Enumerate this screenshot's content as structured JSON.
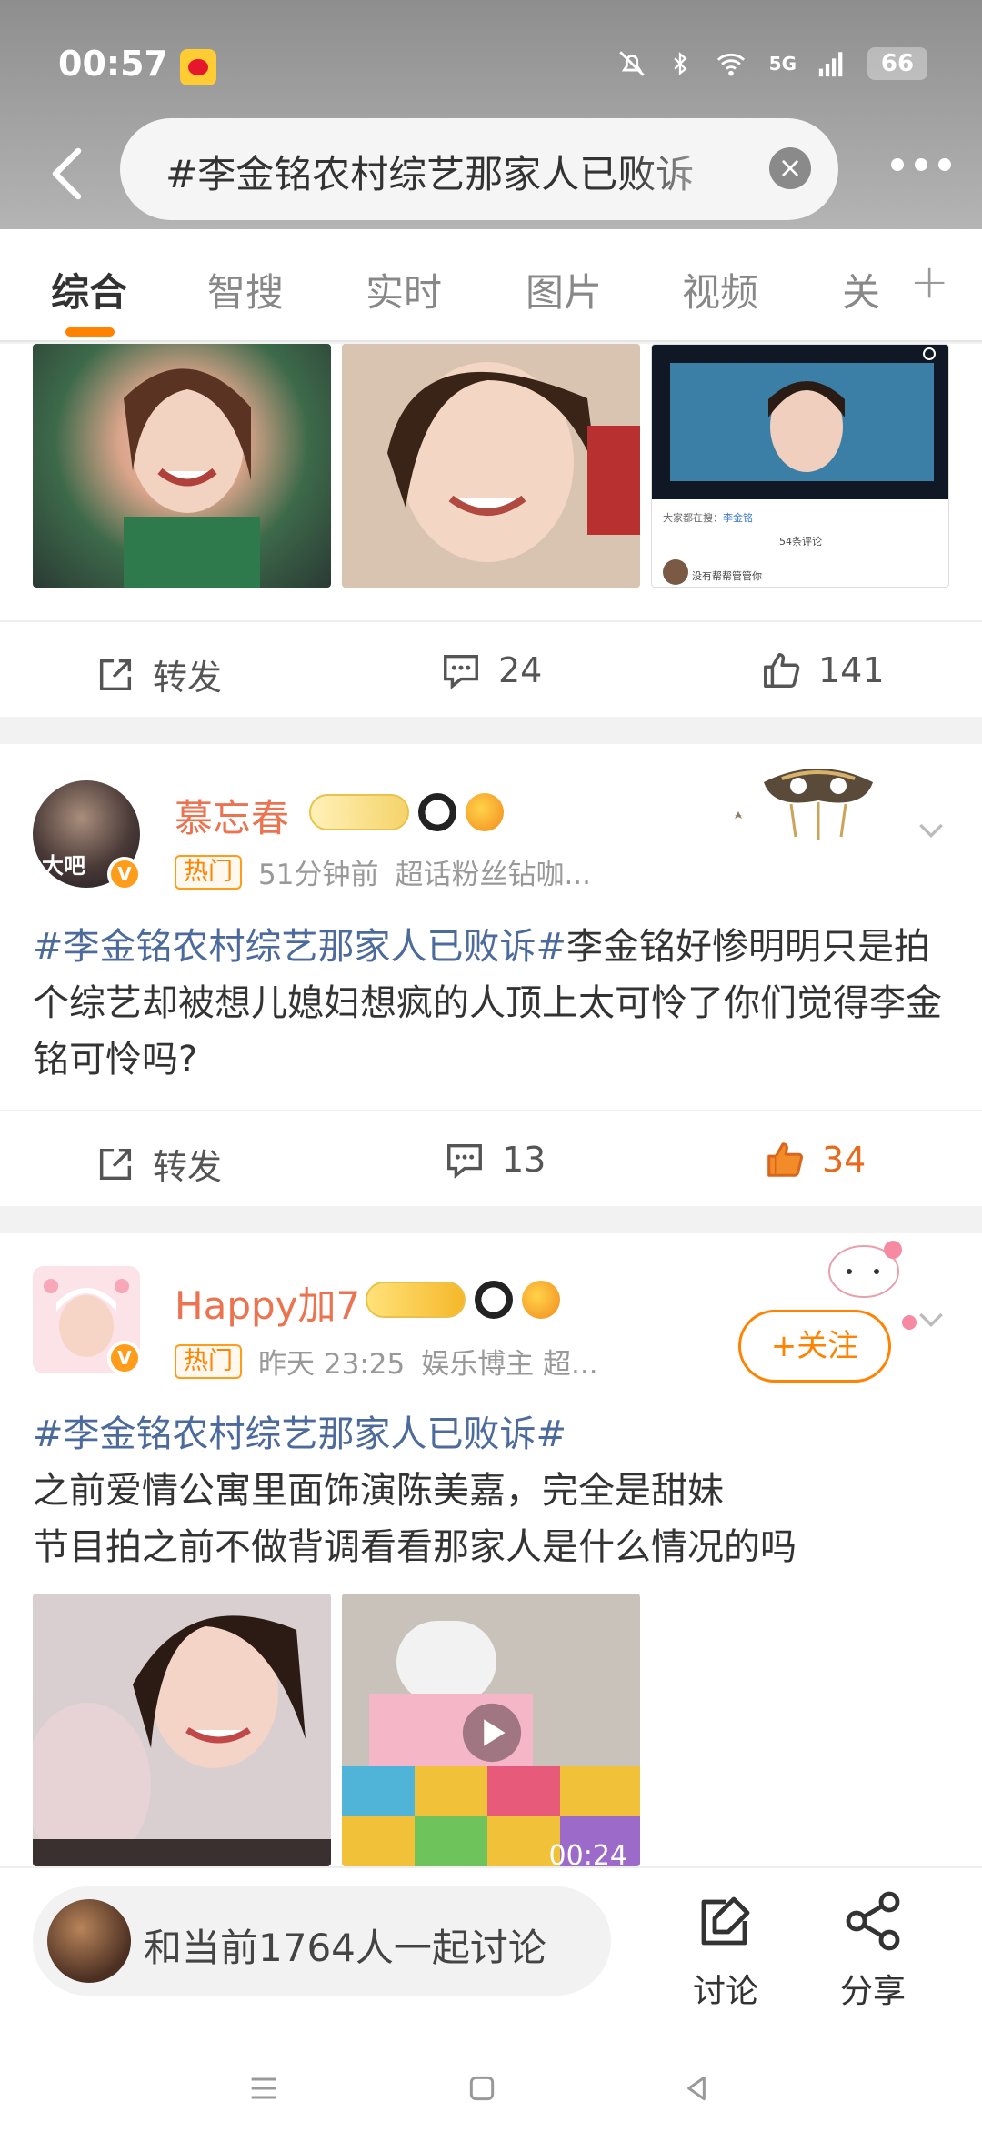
{
  "status": {
    "time": "00:57",
    "battery": "66",
    "network": "5G"
  },
  "search": {
    "query": "#李金铭农村综艺那家人已败诉"
  },
  "tabs": [
    {
      "label": "综合",
      "active": true
    },
    {
      "label": "智搜",
      "active": false
    },
    {
      "label": "实时",
      "active": false
    },
    {
      "label": "图片",
      "active": false
    },
    {
      "label": "视频",
      "active": false
    },
    {
      "label": "关",
      "active": false
    }
  ],
  "tab_plus": "+",
  "post0": {
    "thumb3": {
      "line1_prefix": "大家都在搜：",
      "line1_link": "李金铭",
      "line2": "54条评论",
      "line3": "没有帮帮管管你"
    },
    "actions": {
      "repost": "转发",
      "comments": "24",
      "likes": "141"
    }
  },
  "post1": {
    "username": "慕忘春",
    "avatar_text": "大吧",
    "badge": "热门",
    "time": "51分钟前",
    "source": "超话粉丝钻咖...",
    "hashtag": "#李金铭农村综艺那家人已败诉#",
    "text": "李金铭好惨明明只是拍个综艺却被想儿媳妇想疯的人顶上太可怜了你们觉得李金铭可怜吗?",
    "actions": {
      "repost": "转发",
      "comments": "13",
      "likes": "34"
    }
  },
  "post2": {
    "username": "Happy加7",
    "badge": "热门",
    "time": "昨天 23:25",
    "source": "娱乐博主 超...",
    "follow": "+关注",
    "hashtag": "#李金铭农村综艺那家人已败诉#",
    "line1": "之前爱情公寓里面饰演陈美嘉，完全是甜妹",
    "line2": "节目拍之前不做背调看看那家人是什么情况的吗",
    "video_time": "00:24"
  },
  "bottom": {
    "discuss": "和当前1764人一起讨论",
    "discuss_btn": "讨论",
    "share_btn": "分享"
  },
  "colors": {
    "accent": "#ff8200",
    "tag": "#4c6a9c",
    "username": "#eb7350",
    "liked": "#e86a1d"
  }
}
